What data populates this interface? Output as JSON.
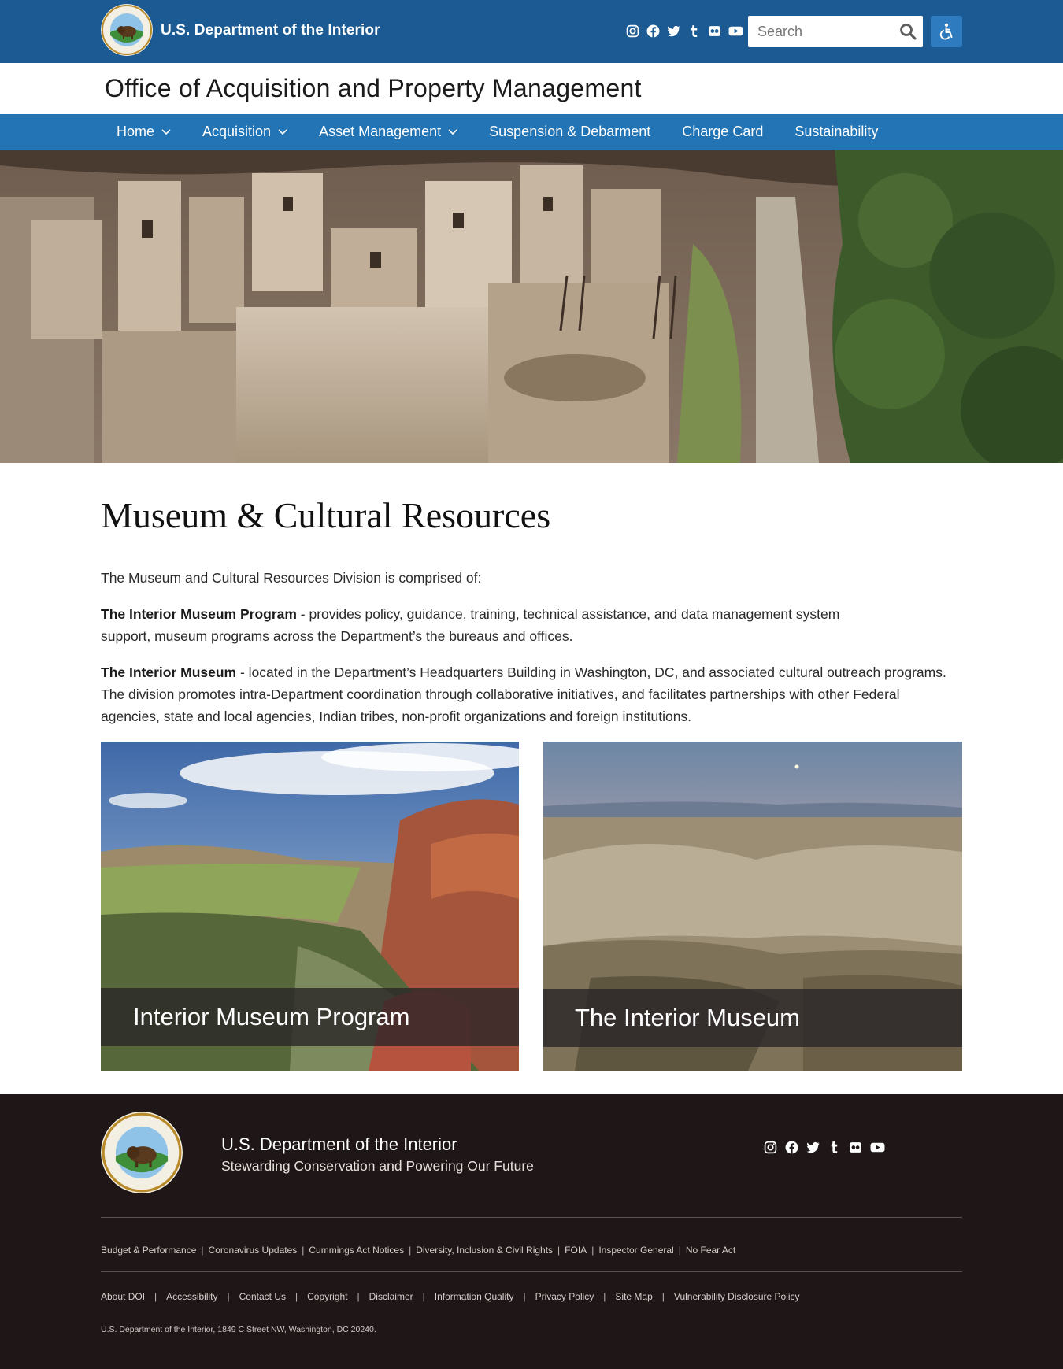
{
  "header": {
    "agency_name": "U.S. Department of the Interior",
    "social_icons": [
      "instagram-icon",
      "facebook-icon",
      "twitter-icon",
      "tumblr-icon",
      "flickr-icon",
      "youtube-icon"
    ],
    "search": {
      "placeholder": "Search",
      "value": ""
    },
    "accessibility_button_icon": "wheelchair-icon"
  },
  "office_title": "Office of Acquisition and Property Management",
  "nav": {
    "items": [
      {
        "label": "Home",
        "has_dropdown": true
      },
      {
        "label": "Acquisition",
        "has_dropdown": true
      },
      {
        "label": "Asset Management",
        "has_dropdown": true
      },
      {
        "label": "Suspension & Debarment",
        "has_dropdown": false
      },
      {
        "label": "Charge Card",
        "has_dropdown": false
      },
      {
        "label": "Sustainability",
        "has_dropdown": false
      }
    ]
  },
  "main": {
    "title": "Museum & Cultural Resources",
    "intro": "The Museum and Cultural Resources Division is comprised of:",
    "program": {
      "term": "The Interior Museum Program",
      "text": " - provides policy, guidance, training, technical assistance, and data management system support, museum programs across the Department’s the bureaus and offices."
    },
    "museum": {
      "term": "The Interior Museum",
      "text": " - located in the Department’s Headquarters Building in Washington, DC, and associated cultural outreach programs. The division promotes intra-Department coordination through collaborative initiatives, and facilitates partnerships with other Federal agencies, state and local agencies, Indian tribes, non-profit organizations and foreign institutions."
    },
    "cards": [
      {
        "label": "Interior Museum Program"
      },
      {
        "label": "The Interior Museum"
      }
    ]
  },
  "footer": {
    "agency_name": "U.S. Department of the Interior",
    "tagline": "Stewarding Conservation and Powering Our Future",
    "links_row1": [
      "Budget & Performance",
      "Coronavirus Updates",
      "Cummings Act Notices",
      "Diversity, Inclusion & Civil Rights",
      "FOIA",
      "Inspector General",
      "No Fear Act"
    ],
    "links_row2": [
      "About DOI",
      "Accessibility",
      "Contact Us",
      "Copyright",
      "Disclaimer",
      "Information Quality",
      "Privacy Policy",
      "Site Map",
      "Vulnerability Disclosure Policy"
    ],
    "address": "U.S. Department of the Interior, 1849 C Street NW, Washington, DC 20240."
  },
  "colors": {
    "topbar": "#1b5a92",
    "nav": "#2274b5",
    "accessibility_button": "#2f7bc0",
    "footer": "#1f1717"
  }
}
